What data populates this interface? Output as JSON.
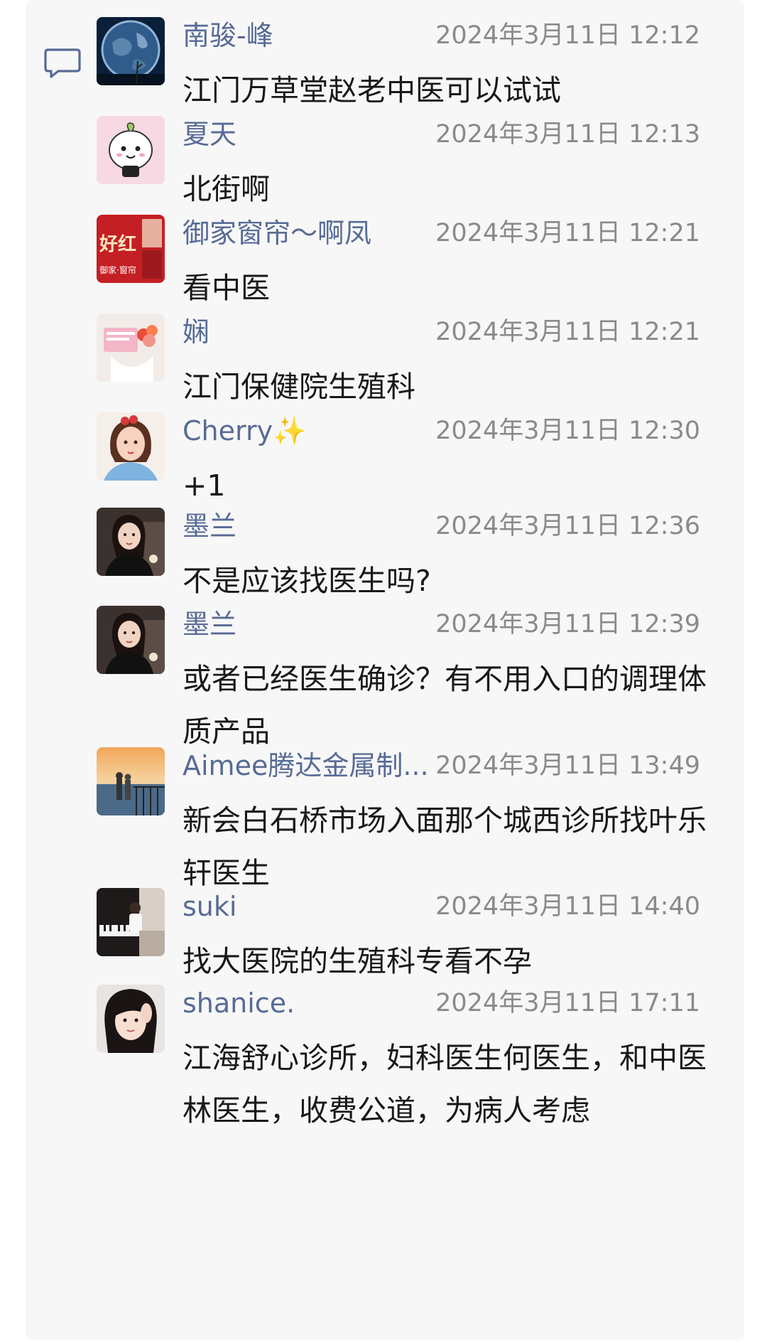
{
  "comments": [
    {
      "name": "南骏-峰",
      "time": "2024年3月11日 12:12",
      "text": "江门万草堂赵老中医可以试试",
      "avatar": "earth-avatar"
    },
    {
      "name": "夏天",
      "time": "2024年3月11日 12:13",
      "text": "北街啊",
      "avatar": "cartoon-avatar"
    },
    {
      "name": "御家窗帘～啊凤",
      "time": "2024年3月11日 12:21",
      "text": "看中医",
      "avatar": "red-poster-avatar",
      "avatar_text_1": "好红",
      "avatar_text_2": "御家·窗帘"
    },
    {
      "name": "娴",
      "time": "2024年3月11日 12:21",
      "text": "江门保健院生殖科",
      "avatar": "flowers-avatar"
    },
    {
      "name": "Cherry✨",
      "time": "2024年3月11日 12:30",
      "text": "+1",
      "avatar": "girl-illustration-avatar"
    },
    {
      "name": "墨兰",
      "time": "2024年3月11日 12:36",
      "text": "不是应该找医生吗?",
      "avatar": "woman-portrait-avatar"
    },
    {
      "name": "墨兰",
      "time": "2024年3月11日 12:39",
      "text": "或者已经医生确诊？有不用入口的调理体质产品",
      "avatar": "woman-portrait-avatar"
    },
    {
      "name": "Aimee腾达金属制...",
      "time": "2024年3月11日 13:49",
      "text": "新会白石桥市场入面那个城西诊所找叶乐轩医生",
      "avatar": "seaside-sunset-avatar"
    },
    {
      "name": "suki",
      "time": "2024年3月11日 14:40",
      "text": "找大医院的生殖科专看不孕",
      "avatar": "piano-avatar"
    },
    {
      "name": "shanice.",
      "time": "2024年3月11日 17:11",
      "text": "江海舒心诊所，妇科医生何医生，和中医林医生，收费公道，为病人考虑",
      "avatar": "selfie-avatar"
    }
  ],
  "colors": {
    "name": "#576b95",
    "time": "#8a8a8a",
    "text": "#191919",
    "panel": "#f7f7f7"
  }
}
